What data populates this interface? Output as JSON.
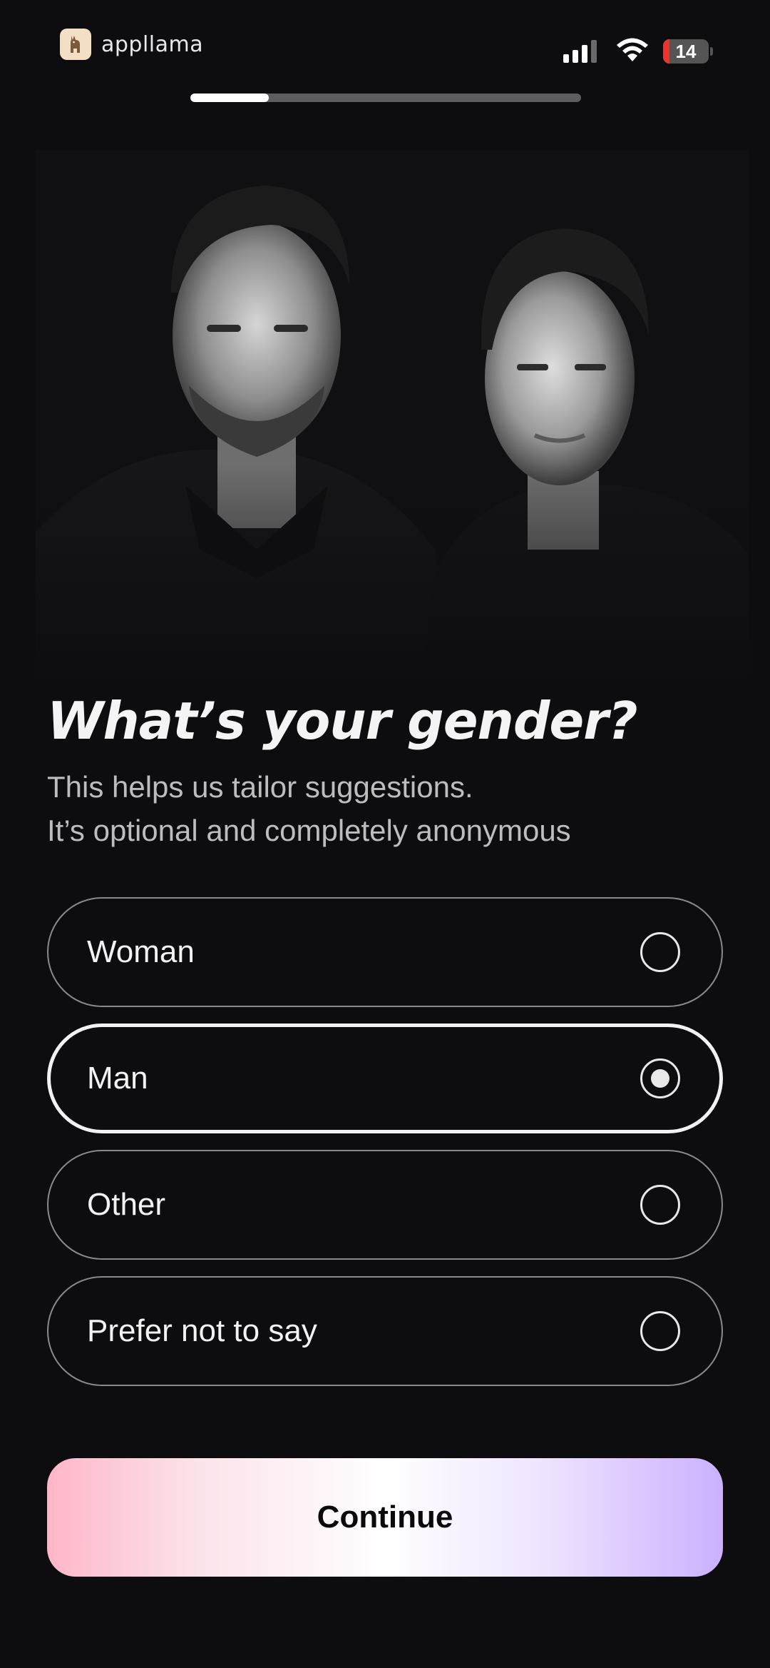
{
  "status_bar": {
    "brand_name": "appllama",
    "battery_level": "14",
    "signal_bars_filled": 3,
    "signal_bars_total": 4
  },
  "progress": {
    "fraction": 0.2
  },
  "hero": {
    "description_icon": "portrait-photo"
  },
  "question": {
    "title": "What’s your gender?",
    "subtitle_line1": "This helps us tailor suggestions.",
    "subtitle_line2": "It’s optional and completely anonymous"
  },
  "options": [
    {
      "label": "Woman",
      "selected": false
    },
    {
      "label": "Man",
      "selected": true
    },
    {
      "label": "Other",
      "selected": false
    },
    {
      "label": "Prefer not to say",
      "selected": false
    }
  ],
  "continue_button": {
    "label": "Continue"
  },
  "colors": {
    "background": "#0d0d0f",
    "battery_low": "#e5372f",
    "gradient_start": "#ffb6c8",
    "gradient_end": "#cbb1ff"
  }
}
